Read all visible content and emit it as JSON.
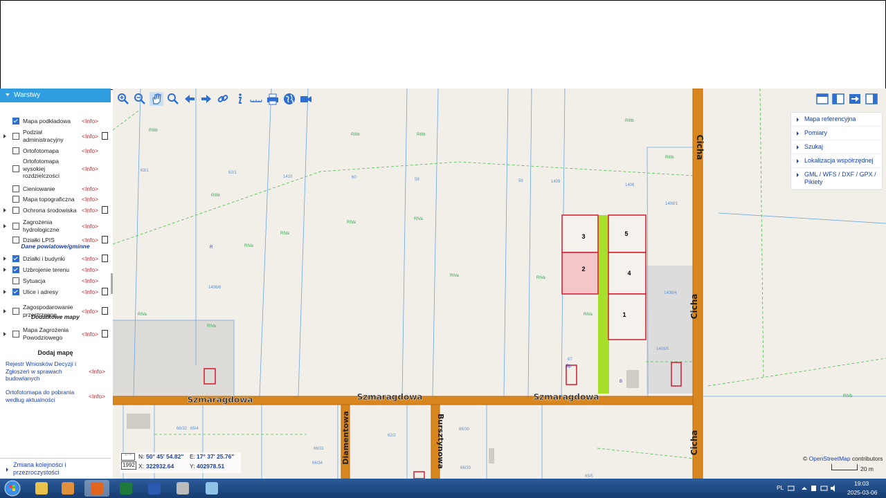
{
  "sidebar": {
    "header": "Warstwy",
    "layers": [
      {
        "label": "Mapa podkładowa",
        "checked": true,
        "expand": false,
        "doc": false,
        "info": "<Info>"
      },
      {
        "label": "Podział administracyjny",
        "checked": false,
        "expand": true,
        "doc": true,
        "info": "<Info>"
      },
      {
        "label": "Ortofotomapa",
        "checked": false,
        "expand": false,
        "doc": false,
        "info": "<Info>"
      },
      {
        "label": "Ortofotomapa wysokiej rozdzielczości",
        "checked": false,
        "expand": false,
        "doc": false,
        "info": "<Info>"
      },
      {
        "label": "Cieniowanie",
        "checked": false,
        "expand": false,
        "doc": false,
        "info": "<Info>"
      },
      {
        "label": "Mapa topograficzna",
        "checked": false,
        "expand": false,
        "doc": false,
        "info": "<Info>"
      },
      {
        "label": "Ochrona środowiska",
        "checked": false,
        "expand": true,
        "doc": true,
        "info": "<Info>"
      },
      {
        "label": "Zagrożenia hydrologiczne",
        "checked": false,
        "expand": true,
        "doc": false,
        "info": "<Info>"
      },
      {
        "label": "Działki LPIS",
        "checked": false,
        "expand": false,
        "doc": true,
        "info": "<Info>"
      },
      {
        "label": "Działki i budynki",
        "checked": true,
        "expand": true,
        "doc": true,
        "info": "<Info>"
      },
      {
        "label": "Uzbrojenie terenu",
        "checked": true,
        "expand": true,
        "doc": false,
        "info": "<Info>"
      },
      {
        "label": "Sytuacja",
        "checked": false,
        "expand": false,
        "doc": false,
        "info": "<Info>"
      },
      {
        "label": "Ulice i adresy",
        "checked": true,
        "expand": true,
        "doc": true,
        "info": "<Info>"
      },
      {
        "label": "Zagospodarowanie przestrzenne",
        "checked": false,
        "expand": true,
        "doc": true,
        "info": "<Info>"
      },
      {
        "label": "Mapa Zagrożenia Powodziowego",
        "checked": false,
        "expand": true,
        "doc": true,
        "info": "<Info>"
      }
    ],
    "section_powiat": "Dane powiatowe/gminne",
    "section_extra": "Dodatkowe mapy",
    "add_map": "Dodaj mapę",
    "extra_links": [
      {
        "label": "Rejestr Wniosków Decyzji i Zgłoszeń w sprawach budowlanych",
        "info": "<Info>"
      },
      {
        "label": "Ortofotomapa do pobrania według aktualności",
        "info": "<Info>"
      }
    ],
    "footer": "Zmiana kolejności i przezroczystości"
  },
  "toolbar_icons": [
    "zoom-in-icon",
    "zoom-out-icon",
    "pan-hand-icon",
    "zoom-box-icon",
    "back-arrow-icon",
    "forward-arrow-icon",
    "link-icon",
    "info-icon",
    "measure-icon",
    "print-icon",
    "globe-icon",
    "camera-icon"
  ],
  "right_panel": [
    "Mapa referencyjna",
    "Pomiary",
    "Szukaj",
    "Lokalizacja współrzędnej",
    "GML / WFS / DXF / GPX / Pikiety"
  ],
  "coords": {
    "n_label": "N:",
    "n_value": "50° 45' 54.82\"",
    "e_label": "E:",
    "e_value": "17° 37' 25.76\"",
    "x_label": "X:",
    "x_value": "322932.64",
    "y_label": "Y:",
    "y_value": "402978.51",
    "crs": "1992",
    "format_btn": "° ' \""
  },
  "attribution": {
    "prefix": "© ",
    "link": "OpenStreetMap",
    "suffix": " contributors"
  },
  "scale_label": "20 m",
  "streets": {
    "szmaragdowa": "Szmaragdowa",
    "cicha": "Cicha",
    "diamentowa": "Diamentowa",
    "bursztynowa": "Bursztynowa"
  },
  "plots": {
    "p1": "1",
    "p2": "2",
    "p3": "3",
    "p4": "4",
    "p5": "5"
  },
  "map_labels": [
    "RIIIb",
    "RIIIb",
    "RIIIb",
    "RIIIb",
    "RIIIb",
    "RIIIb",
    "RIVa",
    "RIVa",
    "RIVa",
    "RIVa",
    "RIVa",
    "RIVa",
    "RIVa",
    "RIVa",
    "RIVa",
    "RIVb",
    "R",
    "63/1",
    "62/1",
    "1410",
    "60",
    "59",
    "58",
    "1409",
    "1408",
    "1408/1",
    "1408/4",
    "1406/5",
    "1406/6",
    "62/2",
    "66/30",
    "66/33",
    "66/34",
    "66/31",
    "66/32",
    "65/4",
    "65/5",
    "67",
    "B",
    "Bp"
  ],
  "taskbar": {
    "apps": [
      "start-orb-icon",
      "explorer-icon",
      "media-player-icon",
      "firefox-icon",
      "excel-icon",
      "word-icon",
      "calculator-icon",
      "paint-icon"
    ],
    "lang": "PL",
    "time": "19:03",
    "date": "2025-03-06"
  }
}
